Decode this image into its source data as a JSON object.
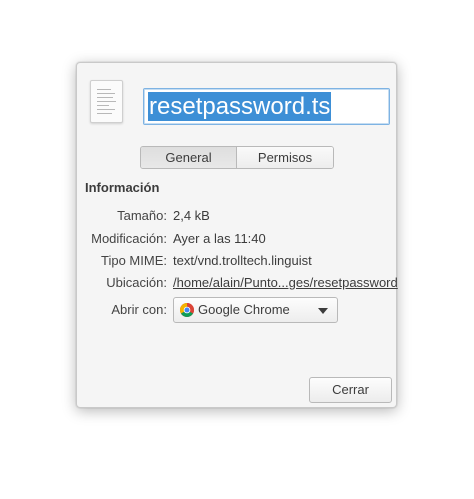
{
  "dialog": {
    "file_icon": "text-document-icon",
    "filename": "resetpassword.ts",
    "tabs": [
      {
        "label": "General",
        "active": true
      },
      {
        "label": "Permisos",
        "active": false
      }
    ],
    "section_title": "Información",
    "info": {
      "size_label": "Tamaño:",
      "size_value": "2,4 kB",
      "modified_label": "Modificación:",
      "modified_value": "Ayer a las 11:40",
      "mime_label": "Tipo MIME:",
      "mime_value": "text/vnd.trolltech.linguist",
      "location_label": "Ubicación:",
      "location_value": "/home/alain/Punto...ges/resetpassword",
      "open_with_label": "Abrir con:",
      "open_with_value": "Google Chrome",
      "open_with_icon": "chrome-icon"
    },
    "close_label": "Cerrar"
  },
  "colors": {
    "selection": "#3d8fd6",
    "focus_border": "#7eb3e3",
    "dialog_bg": "#f5f5f5"
  }
}
